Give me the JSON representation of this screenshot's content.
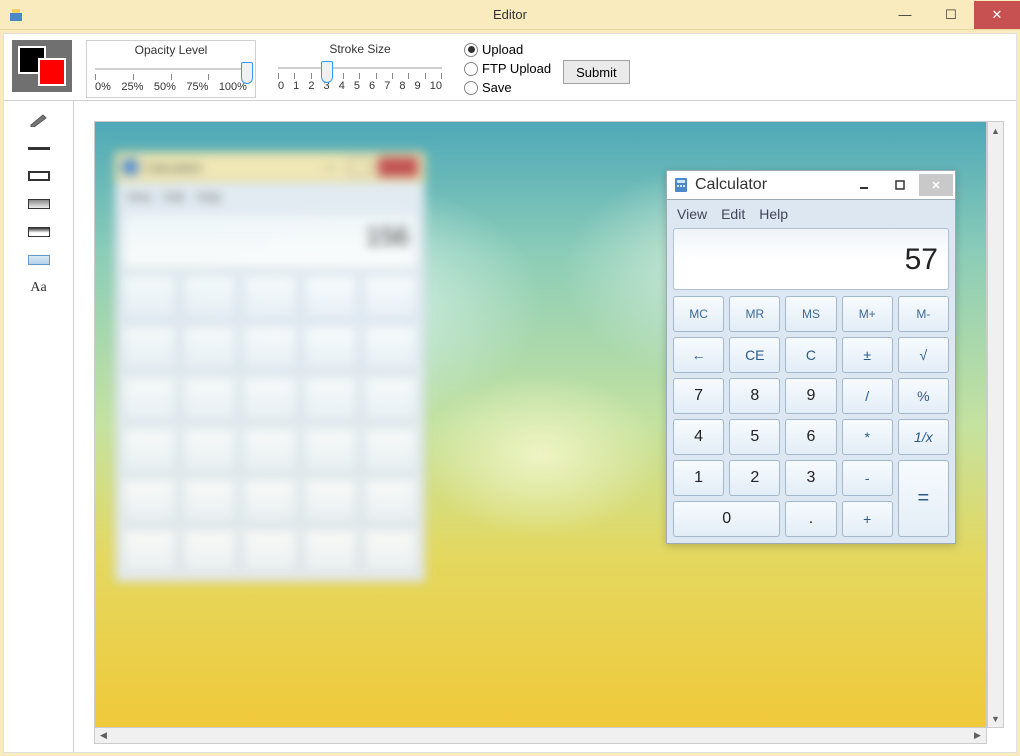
{
  "window": {
    "title": "Editor",
    "min": "—",
    "max": "☐",
    "close": "✕"
  },
  "toolbar": {
    "opacity_label": "Opacity Level",
    "opacity_ticks": [
      "0%",
      "25%",
      "50%",
      "75%",
      "100%"
    ],
    "stroke_label": "Stroke Size",
    "stroke_ticks": [
      "0",
      "1",
      "2",
      "3",
      "4",
      "5",
      "6",
      "7",
      "8",
      "9",
      "10"
    ],
    "radio_upload": "Upload",
    "radio_ftp": "FTP Upload",
    "radio_save": "Save",
    "submit": "Submit"
  },
  "tools": {
    "text": "Aa"
  },
  "calc_blur": {
    "title": "Calculator",
    "menu": [
      "View",
      "Edit",
      "Help"
    ],
    "display": "156"
  },
  "calc_sharp": {
    "title": "Calculator",
    "menu_view": "View",
    "menu_edit": "Edit",
    "menu_help": "Help",
    "display": "57",
    "btns": {
      "mc": "MC",
      "mr": "MR",
      "ms": "MS",
      "mplus": "M+",
      "mminus": "M-",
      "back": "←",
      "ce": "CE",
      "c": "C",
      "pm": "±",
      "sqrt": "√",
      "n7": "7",
      "n8": "8",
      "n9": "9",
      "div": "/",
      "pct": "%",
      "n4": "4",
      "n5": "5",
      "n6": "6",
      "mul": "*",
      "inv": "1/x",
      "n1": "1",
      "n2": "2",
      "n3": "3",
      "sub": "-",
      "eq": "=",
      "n0": "0",
      "dot": ".",
      "add": "+"
    }
  }
}
